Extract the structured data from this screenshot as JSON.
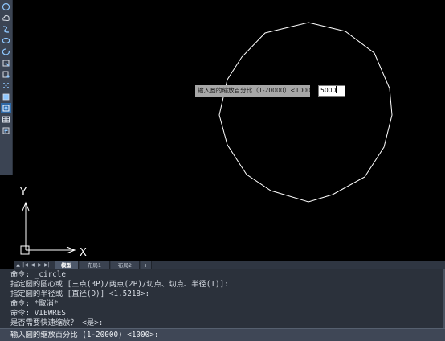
{
  "toolbar": {
    "tools": [
      {
        "icon": "circle-arc-icon"
      },
      {
        "icon": "cloud-icon"
      },
      {
        "icon": "spline-icon"
      },
      {
        "icon": "ellipse-icon"
      },
      {
        "icon": "ellipse-arc-icon"
      },
      {
        "icon": "insert-block-icon"
      },
      {
        "icon": "make-block-icon"
      },
      {
        "icon": "point-icon"
      },
      {
        "icon": "hatch-icon"
      },
      {
        "icon": "gradient-icon"
      },
      {
        "icon": "table-icon"
      },
      {
        "icon": "mtext-icon"
      }
    ]
  },
  "canvas": {
    "ucs_y_label": "Y",
    "ucs_x_label": "X",
    "dynamic_prompt": "输入圆的缩放百分比（1-20000）<1000>:",
    "dynamic_input_value": "5000"
  },
  "tabs": {
    "items": [
      "模型",
      "布局1",
      "布局2"
    ],
    "active": "模型",
    "add_label": "+"
  },
  "command_history": [
    "命令: _circle",
    "指定圆的圆心或 [三点(3P)/两点(2P)/切点、切点、半径(T)]:",
    "指定圆的半径或 [直径(D)] <1.5218>:",
    "命令: *取消*",
    "命令: VIEWRES",
    "是否需要快速缩放？ <是>:"
  ],
  "command_prompt": "输入圆的缩放百分比 (1-20000) <1000>:"
}
